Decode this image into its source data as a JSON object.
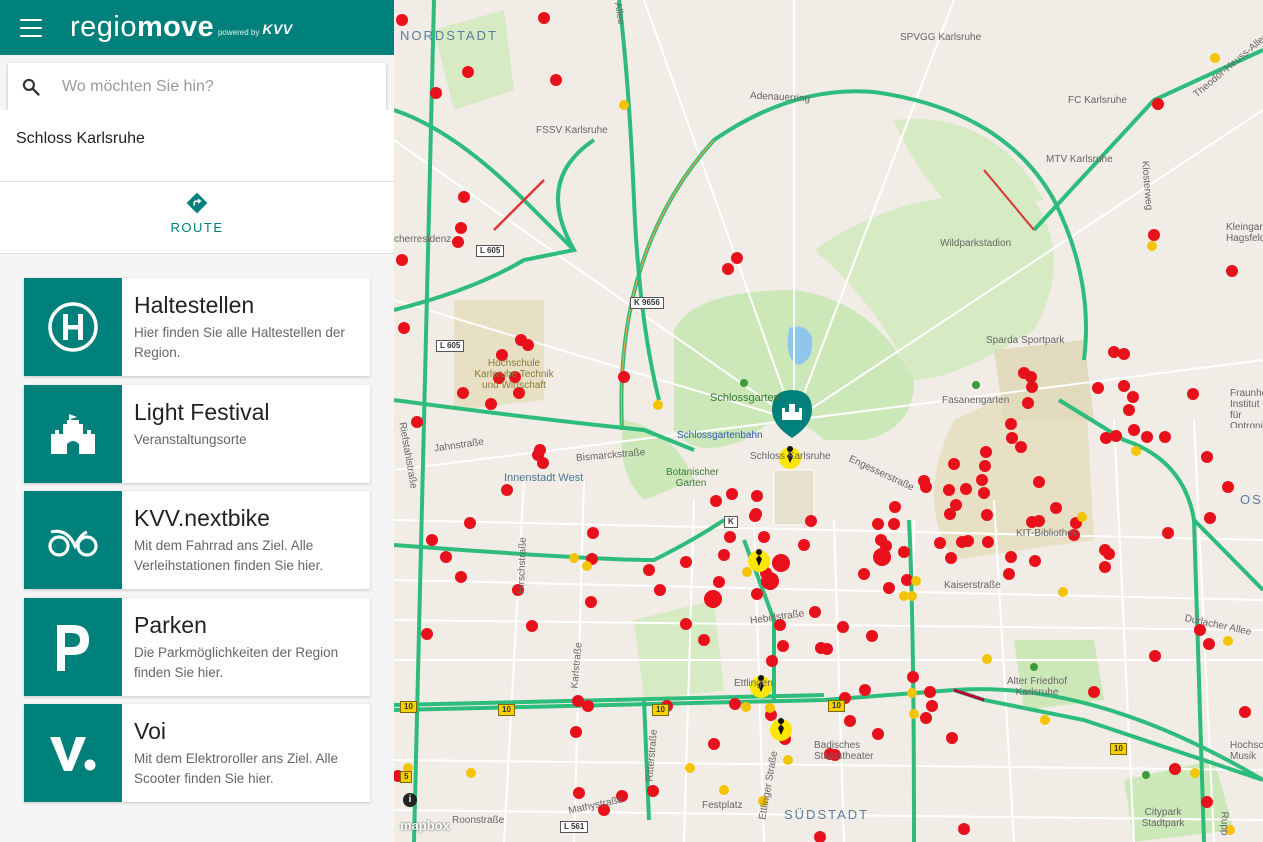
{
  "brand": {
    "regio": "regio",
    "move": "move",
    "powered": "powered by",
    "kvv": "KVV"
  },
  "search": {
    "placeholder": "Wo möchten Sie hin?"
  },
  "place": {
    "title": "Schloss Karlsruhe"
  },
  "route": {
    "label": "ROUTE"
  },
  "cards": [
    {
      "title": "Haltestellen",
      "desc": "Hier finden Sie alle Haltestellen der Region.",
      "icon": "bus-stop-h-icon"
    },
    {
      "title": "Light Festival",
      "desc": "Veranstaltungsorte",
      "icon": "castle-icon"
    },
    {
      "title": "KVV.nextbike",
      "desc": "Mit dem Fahrrad ans Ziel. Alle Verleihstationen finden Sie hier.",
      "icon": "bike-icon"
    },
    {
      "title": "Parken",
      "desc": "Die Parkmöglichkeiten der Region finden Sie hier.",
      "icon": "parking-icon"
    },
    {
      "title": "Voi",
      "desc": "Mit dem Elektroroller ans Ziel. Alle Scooter finden Sie hier.",
      "icon": "voi-icon"
    }
  ],
  "map": {
    "districts": {
      "nordstadt": "NORDSTADT",
      "suedstadt": "SÜDSTADT",
      "ost": "OST"
    },
    "labels": {
      "adenauerring": "Adenauerring",
      "fssv": "FSSV Karlsruhe",
      "spvgg": "SPVGG Karlsruhe",
      "fc": "FC Karlsruhe",
      "mtv": "MTV Karlsruhe",
      "wildpark": "Wildparkstadion",
      "sparda": "Sparda Sportpark",
      "fasanengarten": "Fasanengarten",
      "schlossgarten": "Schlossgarten",
      "schlossgartenbahn": "Schlossgartenbahn",
      "schloss": "Schloss Karlsruhe",
      "botanischer": "Botanischer Garten",
      "innenstadt_west": "Innenstadt West",
      "bismarck": "Bismarckstraße",
      "hochschule": "Hochschule Karlsruhe Technik und Wirtschaft",
      "kaiserstrasse": "Kaiserstraße",
      "engesser": "Engesserstraße",
      "kit": "KIT-Bibliothek",
      "durlacher": "Durlacher Allee",
      "friedhof": "Alter Friedhof Karlsruhe",
      "ettlinger_strasse": "Ettlinger Straße",
      "ritter": "Ritterstraße",
      "hirsch": "Hirschstraße",
      "karl": "Karlstraße",
      "mathy": "Mathystraße",
      "roon": "Roonstraße",
      "festplatz": "Festplatz",
      "badisches": "Badisches Staatstheater",
      "citypark": "Citypark Stadtpark",
      "theodor": "Theodor-Heuss-Allee",
      "klosterweg": "Klosterweg",
      "jahn": "Jahnstraße",
      "riefstahl": "Riefstahlstraße",
      "allee": "Allee",
      "kleingarten": "Kleingarten Hagsfeld",
      "fraunhofer": "Fraunhofer-Institut für Optronik, Systemtechnik und Bildauswertung",
      "hochschule_musik": "Hochschule Musik",
      "rupp": "Rupp",
      "residenz": "cherresidenz",
      "ettlingen": "Ettlingen",
      "hebel": "Hebelstraße"
    },
    "badges": {
      "l605": "L 605",
      "k9656": "K 9656",
      "b10": "10",
      "l561": "L 561",
      "b5": "5",
      "k": "K"
    },
    "attribution": "mapbox"
  },
  "colors": {
    "brand": "#00807a",
    "stop": "#e8101b",
    "bike": "#f5c400"
  }
}
